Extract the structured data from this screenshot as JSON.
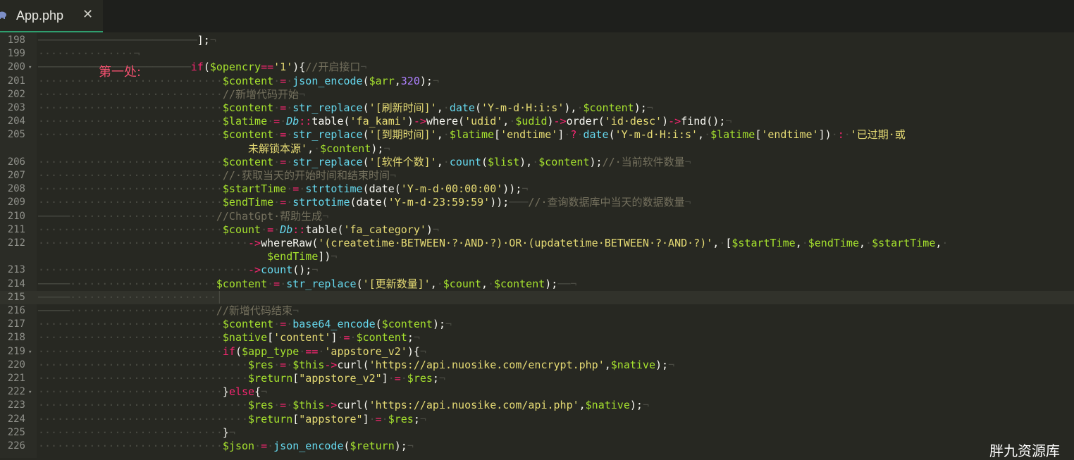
{
  "tab": {
    "title": "App.php",
    "close_glyph": "✕",
    "icon": "php-elephant-icon"
  },
  "annotation": "第一处:",
  "watermark": "胖九资源库",
  "lines": [
    {
      "n": "198",
      "fold": false,
      "segs": [
        [
          "ws",
          "─────────────────────────"
        ],
        [
          "p",
          "];"
        ],
        [
          "ws",
          "¬"
        ]
      ]
    },
    {
      "n": "199",
      "fold": false,
      "segs": [
        [
          "ws",
          "···············¬"
        ]
      ]
    },
    {
      "n": "200",
      "fold": true,
      "segs": [
        [
          "ws",
          "────────────────────────"
        ],
        [
          "kw",
          "if"
        ],
        [
          "p",
          "("
        ],
        [
          "vr",
          "$opencry"
        ],
        [
          "kw",
          "=="
        ],
        [
          "str",
          "'1'"
        ],
        [
          "p",
          "){"
        ],
        [
          "cm",
          "//开启接口"
        ],
        [
          "ws",
          "¬"
        ]
      ]
    },
    {
      "n": "201",
      "fold": false,
      "segs": [
        [
          "ws",
          "·····························"
        ],
        [
          "vr",
          "$content"
        ],
        [
          "ws",
          "·"
        ],
        [
          "kw",
          "="
        ],
        [
          "ws",
          "·"
        ],
        [
          "fn",
          "json_encode"
        ],
        [
          "p",
          "("
        ],
        [
          "vr",
          "$arr"
        ],
        [
          "p",
          ","
        ],
        [
          "num",
          "320"
        ],
        [
          "p",
          ");"
        ],
        [
          "ws",
          "¬"
        ]
      ]
    },
    {
      "n": "202",
      "fold": false,
      "segs": [
        [
          "ws",
          "·····························"
        ],
        [
          "cm",
          "//新增代码开始"
        ],
        [
          "ws",
          "¬"
        ]
      ]
    },
    {
      "n": "203",
      "fold": false,
      "segs": [
        [
          "ws",
          "·····························"
        ],
        [
          "vr",
          "$content"
        ],
        [
          "ws",
          "·"
        ],
        [
          "kw",
          "="
        ],
        [
          "ws",
          "·"
        ],
        [
          "fn",
          "str_replace"
        ],
        [
          "p",
          "("
        ],
        [
          "str",
          "'[刷新时间]'"
        ],
        [
          "p",
          ","
        ],
        [
          "ws",
          "·"
        ],
        [
          "fn",
          "date"
        ],
        [
          "p",
          "("
        ],
        [
          "str",
          "'Y-m-d·H:i:s'"
        ],
        [
          "p",
          "),"
        ],
        [
          "ws",
          "·"
        ],
        [
          "vr",
          "$content"
        ],
        [
          "p",
          ");"
        ],
        [
          "ws",
          "¬"
        ]
      ]
    },
    {
      "n": "204",
      "fold": false,
      "segs": [
        [
          "ws",
          "·····························"
        ],
        [
          "vr",
          "$latime"
        ],
        [
          "ws",
          "·"
        ],
        [
          "kw",
          "="
        ],
        [
          "ws",
          "·"
        ],
        [
          "cl",
          "Db"
        ],
        [
          "kw",
          "::"
        ],
        [
          "p",
          "table("
        ],
        [
          "str",
          "'fa_kami'"
        ],
        [
          "p",
          ")"
        ],
        [
          "kw",
          "->"
        ],
        [
          "p",
          "where("
        ],
        [
          "str",
          "'udid'"
        ],
        [
          "p",
          ","
        ],
        [
          "ws",
          "·"
        ],
        [
          "vr",
          "$udid"
        ],
        [
          "p",
          ")"
        ],
        [
          "kw",
          "->"
        ],
        [
          "p",
          "order("
        ],
        [
          "str",
          "'id·desc'"
        ],
        [
          "p",
          ")"
        ],
        [
          "kw",
          "->"
        ],
        [
          "p",
          "find();"
        ],
        [
          "ws",
          "¬"
        ]
      ]
    },
    {
      "n": "205",
      "fold": false,
      "segs": [
        [
          "ws",
          "·····························"
        ],
        [
          "vr",
          "$content"
        ],
        [
          "ws",
          "·"
        ],
        [
          "kw",
          "="
        ],
        [
          "ws",
          "·"
        ],
        [
          "fn",
          "str_replace"
        ],
        [
          "p",
          "("
        ],
        [
          "str",
          "'[到期时间]'"
        ],
        [
          "p",
          ","
        ],
        [
          "ws",
          "·"
        ],
        [
          "vr",
          "$latime"
        ],
        [
          "p",
          "["
        ],
        [
          "str",
          "'endtime'"
        ],
        [
          "p",
          "]"
        ],
        [
          "ws",
          "·"
        ],
        [
          "kw",
          "?"
        ],
        [
          "ws",
          "·"
        ],
        [
          "fn",
          "date"
        ],
        [
          "p",
          "("
        ],
        [
          "str",
          "'Y-m-d·H:i:s'"
        ],
        [
          "p",
          ","
        ],
        [
          "ws",
          "·"
        ],
        [
          "vr",
          "$latime"
        ],
        [
          "p",
          "["
        ],
        [
          "str",
          "'endtime'"
        ],
        [
          "p",
          "])"
        ],
        [
          "ws",
          "·"
        ],
        [
          "kw",
          ":"
        ],
        [
          "ws",
          "·"
        ],
        [
          "str",
          "'已过期·或"
        ]
      ]
    },
    {
      "n": "",
      "fold": false,
      "segs": [
        [
          "p",
          "                                 "
        ],
        [
          "str",
          "未解锁本源'"
        ],
        [
          "p",
          ","
        ],
        [
          "ws",
          "·"
        ],
        [
          "vr",
          "$content"
        ],
        [
          "p",
          ");"
        ],
        [
          "ws",
          "¬"
        ]
      ]
    },
    {
      "n": "206",
      "fold": false,
      "segs": [
        [
          "ws",
          "·····························"
        ],
        [
          "vr",
          "$content"
        ],
        [
          "ws",
          "·"
        ],
        [
          "kw",
          "="
        ],
        [
          "ws",
          "·"
        ],
        [
          "fn",
          "str_replace"
        ],
        [
          "p",
          "("
        ],
        [
          "str",
          "'[软件个数]'"
        ],
        [
          "p",
          ","
        ],
        [
          "ws",
          "·"
        ],
        [
          "fn",
          "count"
        ],
        [
          "p",
          "("
        ],
        [
          "vr",
          "$list"
        ],
        [
          "p",
          "),"
        ],
        [
          "ws",
          "·"
        ],
        [
          "vr",
          "$content"
        ],
        [
          "p",
          ");"
        ],
        [
          "cm",
          "//·当前软件数量"
        ],
        [
          "ws",
          "¬"
        ]
      ]
    },
    {
      "n": "207",
      "fold": false,
      "segs": [
        [
          "ws",
          "·····························"
        ],
        [
          "cm",
          "//·获取当天的开始时间和结束时间"
        ],
        [
          "ws",
          "¬"
        ]
      ]
    },
    {
      "n": "208",
      "fold": false,
      "segs": [
        [
          "ws",
          "·····························"
        ],
        [
          "vr",
          "$startTime"
        ],
        [
          "ws",
          "·"
        ],
        [
          "kw",
          "="
        ],
        [
          "ws",
          "·"
        ],
        [
          "fn",
          "strtotime"
        ],
        [
          "p",
          "(date("
        ],
        [
          "str",
          "'Y-m-d·00:00:00'"
        ],
        [
          "p",
          "));"
        ],
        [
          "ws",
          "¬"
        ]
      ]
    },
    {
      "n": "209",
      "fold": false,
      "segs": [
        [
          "ws",
          "·····························"
        ],
        [
          "vr",
          "$endTime"
        ],
        [
          "ws",
          "·"
        ],
        [
          "kw",
          "="
        ],
        [
          "ws",
          "·"
        ],
        [
          "fn",
          "strtotime"
        ],
        [
          "p",
          "(date("
        ],
        [
          "str",
          "'Y-m-d·23:59:59'"
        ],
        [
          "p",
          "));"
        ],
        [
          "ws",
          "───"
        ],
        [
          "cm",
          "//·查询数据库中当天的数据数量"
        ],
        [
          "ws",
          "¬"
        ]
      ]
    },
    {
      "n": "210",
      "fold": false,
      "segs": [
        [
          "ws",
          "─────·······················"
        ],
        [
          "cm",
          "//ChatGpt·帮助生成"
        ],
        [
          "ws",
          "¬"
        ]
      ]
    },
    {
      "n": "211",
      "fold": false,
      "segs": [
        [
          "ws",
          "·····························"
        ],
        [
          "vr",
          "$count"
        ],
        [
          "ws",
          "·"
        ],
        [
          "kw",
          "="
        ],
        [
          "ws",
          "·"
        ],
        [
          "cl",
          "Db"
        ],
        [
          "kw",
          "::"
        ],
        [
          "p",
          "table("
        ],
        [
          "str",
          "'fa_category'"
        ],
        [
          "p",
          ")"
        ],
        [
          "ws",
          "¬"
        ]
      ]
    },
    {
      "n": "212",
      "fold": false,
      "segs": [
        [
          "ws",
          "·································"
        ],
        [
          "kw",
          "->"
        ],
        [
          "p",
          "whereRaw("
        ],
        [
          "str",
          "'(createtime·BETWEEN·?·AND·?)·OR·(updatetime·BETWEEN·?·AND·?)'"
        ],
        [
          "p",
          ","
        ],
        [
          "ws",
          "·"
        ],
        [
          "p",
          "["
        ],
        [
          "vr",
          "$startTime"
        ],
        [
          "p",
          ","
        ],
        [
          "ws",
          "·"
        ],
        [
          "vr",
          "$endTime"
        ],
        [
          "p",
          ","
        ],
        [
          "ws",
          "·"
        ],
        [
          "vr",
          "$startTime"
        ],
        [
          "p",
          ","
        ],
        [
          "ws",
          "·"
        ]
      ]
    },
    {
      "n": "",
      "fold": false,
      "segs": [
        [
          "p",
          "                                    "
        ],
        [
          "vr",
          "$endTime"
        ],
        [
          "p",
          "])"
        ],
        [
          "ws",
          "¬"
        ]
      ]
    },
    {
      "n": "213",
      "fold": false,
      "segs": [
        [
          "ws",
          "·································"
        ],
        [
          "kw",
          "->"
        ],
        [
          "fn",
          "count"
        ],
        [
          "p",
          "();"
        ],
        [
          "ws",
          "¬"
        ]
      ]
    },
    {
      "n": "214",
      "fold": false,
      "segs": [
        [
          "ws",
          "─────·······················"
        ],
        [
          "vr",
          "$content"
        ],
        [
          "ws",
          "·"
        ],
        [
          "kw",
          "="
        ],
        [
          "ws",
          "·"
        ],
        [
          "fn",
          "str_replace"
        ],
        [
          "p",
          "("
        ],
        [
          "str",
          "'[更新数量]'"
        ],
        [
          "p",
          ","
        ],
        [
          "ws",
          "·"
        ],
        [
          "vr",
          "$count"
        ],
        [
          "p",
          ","
        ],
        [
          "ws",
          "·"
        ],
        [
          "vr",
          "$content"
        ],
        [
          "p",
          ");"
        ],
        [
          "ws",
          "──¬"
        ]
      ]
    },
    {
      "n": "215",
      "fold": false,
      "cursor": true,
      "segs": [
        [
          "ws",
          "─────·······················│"
        ]
      ]
    },
    {
      "n": "216",
      "fold": false,
      "segs": [
        [
          "ws",
          "─────·······················"
        ],
        [
          "cm",
          "//新增代码结束"
        ],
        [
          "ws",
          "¬"
        ]
      ]
    },
    {
      "n": "217",
      "fold": false,
      "segs": [
        [
          "ws",
          "·····························"
        ],
        [
          "vr",
          "$content"
        ],
        [
          "ws",
          "·"
        ],
        [
          "kw",
          "="
        ],
        [
          "ws",
          "·"
        ],
        [
          "fn",
          "base64_encode"
        ],
        [
          "p",
          "("
        ],
        [
          "vr",
          "$content"
        ],
        [
          "p",
          ");"
        ],
        [
          "ws",
          "¬"
        ]
      ]
    },
    {
      "n": "218",
      "fold": false,
      "segs": [
        [
          "ws",
          "·····························"
        ],
        [
          "vr",
          "$native"
        ],
        [
          "p",
          "["
        ],
        [
          "str",
          "'content'"
        ],
        [
          "p",
          "]"
        ],
        [
          "ws",
          "·"
        ],
        [
          "kw",
          "="
        ],
        [
          "ws",
          "·"
        ],
        [
          "vr",
          "$content"
        ],
        [
          "p",
          ";"
        ],
        [
          "ws",
          "¬"
        ]
      ]
    },
    {
      "n": "219",
      "fold": true,
      "segs": [
        [
          "ws",
          "·····························"
        ],
        [
          "kw",
          "if"
        ],
        [
          "p",
          "("
        ],
        [
          "vr",
          "$app_type"
        ],
        [
          "ws",
          "·"
        ],
        [
          "kw",
          "=="
        ],
        [
          "ws",
          "·"
        ],
        [
          "str",
          "'appstore_v2'"
        ],
        [
          "p",
          "){"
        ],
        [
          "ws",
          "¬"
        ]
      ]
    },
    {
      "n": "220",
      "fold": false,
      "segs": [
        [
          "ws",
          "·································"
        ],
        [
          "vr",
          "$res"
        ],
        [
          "ws",
          "·"
        ],
        [
          "kw",
          "="
        ],
        [
          "ws",
          "·"
        ],
        [
          "vr",
          "$this"
        ],
        [
          "kw",
          "->"
        ],
        [
          "p",
          "curl("
        ],
        [
          "str",
          "'https://api.nuosike.com/encrypt.php'"
        ],
        [
          "p",
          ","
        ],
        [
          "vr",
          "$native"
        ],
        [
          "p",
          ");"
        ],
        [
          "ws",
          "¬"
        ]
      ]
    },
    {
      "n": "221",
      "fold": false,
      "segs": [
        [
          "ws",
          "·································"
        ],
        [
          "vr",
          "$return"
        ],
        [
          "p",
          "["
        ],
        [
          "str",
          "\"appstore_v2\""
        ],
        [
          "p",
          "]"
        ],
        [
          "ws",
          "·"
        ],
        [
          "kw",
          "="
        ],
        [
          "ws",
          "·"
        ],
        [
          "vr",
          "$res"
        ],
        [
          "p",
          ";"
        ],
        [
          "ws",
          "¬"
        ]
      ]
    },
    {
      "n": "222",
      "fold": true,
      "segs": [
        [
          "ws",
          "·····························"
        ],
        [
          "p",
          "}"
        ],
        [
          "kw",
          "else"
        ],
        [
          "p",
          "{"
        ],
        [
          "ws",
          "¬"
        ]
      ]
    },
    {
      "n": "223",
      "fold": false,
      "segs": [
        [
          "ws",
          "·································"
        ],
        [
          "vr",
          "$res"
        ],
        [
          "ws",
          "·"
        ],
        [
          "kw",
          "="
        ],
        [
          "ws",
          "·"
        ],
        [
          "vr",
          "$this"
        ],
        [
          "kw",
          "->"
        ],
        [
          "p",
          "curl("
        ],
        [
          "str",
          "'https://api.nuosike.com/api.php'"
        ],
        [
          "p",
          ","
        ],
        [
          "vr",
          "$native"
        ],
        [
          "p",
          ");"
        ],
        [
          "ws",
          "¬"
        ]
      ]
    },
    {
      "n": "224",
      "fold": false,
      "segs": [
        [
          "ws",
          "·································"
        ],
        [
          "vr",
          "$return"
        ],
        [
          "p",
          "["
        ],
        [
          "str",
          "\"appstore\""
        ],
        [
          "p",
          "]"
        ],
        [
          "ws",
          "·"
        ],
        [
          "kw",
          "="
        ],
        [
          "ws",
          "·"
        ],
        [
          "vr",
          "$res"
        ],
        [
          "p",
          ";"
        ],
        [
          "ws",
          "¬"
        ]
      ]
    },
    {
      "n": "225",
      "fold": false,
      "segs": [
        [
          "ws",
          "·····························"
        ],
        [
          "p",
          "}"
        ],
        [
          "ws",
          "¬"
        ]
      ]
    },
    {
      "n": "226",
      "fold": false,
      "segs": [
        [
          "ws",
          "·····························"
        ],
        [
          "vr",
          "$json"
        ],
        [
          "ws",
          "·"
        ],
        [
          "kw",
          "="
        ],
        [
          "ws",
          "·"
        ],
        [
          "fn",
          "json_encode"
        ],
        [
          "p",
          "("
        ],
        [
          "vr",
          "$return"
        ],
        [
          "p",
          ");"
        ],
        [
          "ws",
          "¬"
        ]
      ]
    }
  ]
}
